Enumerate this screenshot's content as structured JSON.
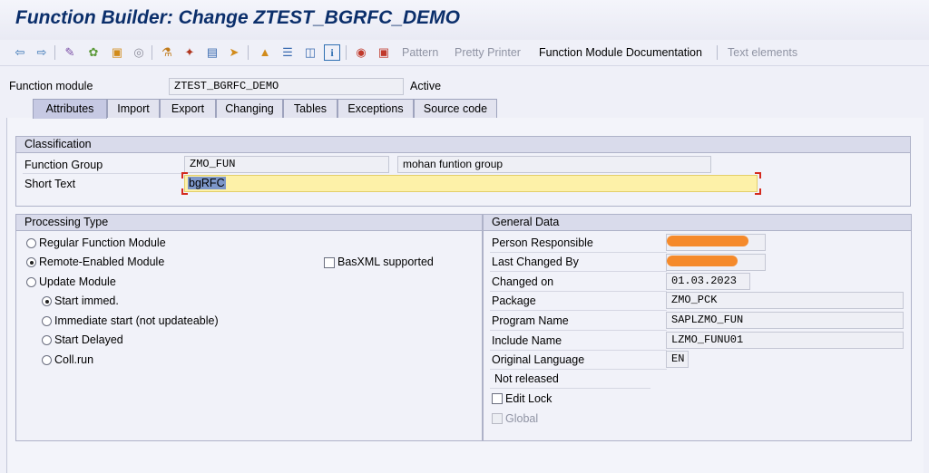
{
  "window": {
    "title": "Function Builder: Change ZTEST_BGRFC_DEMO"
  },
  "toolbar": {
    "icons": [
      "back-icon",
      "forward-icon",
      "display-change-icon",
      "object-list-icon",
      "other-object-icon",
      "where-used-icon",
      "check-icon",
      "activate-icon",
      "test-icon",
      "navigation-window-icon",
      "hierarchy-icon",
      "stack-icon",
      "layout-icon",
      "info-icon",
      "breakpoint-icon",
      "session-breakpoint-icon"
    ],
    "pattern": "Pattern",
    "pretty_printer": "Pretty Printer",
    "fm_documentation": "Function Module Documentation",
    "text_elements": "Text elements"
  },
  "header": {
    "function_module_label": "Function module",
    "function_module_value": "ZTEST_BGRFC_DEMO",
    "status": "Active"
  },
  "tabs": [
    "Attributes",
    "Import",
    "Export",
    "Changing",
    "Tables",
    "Exceptions",
    "Source code"
  ],
  "active_tab": "Attributes",
  "classification": {
    "title": "Classification",
    "function_group_label": "Function Group",
    "function_group_value": "ZMO_FUN",
    "function_group_desc": "mohan funtion group",
    "short_text_label": "Short Text",
    "short_text_value": "bgRFC"
  },
  "processing": {
    "title": "Processing Type",
    "regular": "Regular Function Module",
    "remote": "Remote-Enabled Module",
    "basxml": "BasXML supported",
    "update": "Update Module",
    "start_immed": "Start immed.",
    "immediate_start": "Immediate start (not updateable)",
    "start_delayed": "Start Delayed",
    "coll_run": "Coll.run",
    "selected_main": "remote",
    "selected_update": "start_immed"
  },
  "general": {
    "title": "General Data",
    "person_label": "Person Responsible",
    "last_changed_label": "Last Changed By",
    "changed_on_label": "Changed on",
    "changed_on_value": "01.03.2023",
    "package_label": "Package",
    "package_value": "ZMO_PCK",
    "program_label": "Program Name",
    "program_value": "SAPLZMO_FUN",
    "include_label": "Include Name",
    "include_value": "LZMO_FUNU01",
    "language_label": "Original Language",
    "language_value": "EN",
    "release_status": "Not released",
    "edit_lock": "Edit Lock",
    "global": "Global"
  },
  "colors": {
    "title": "#0b2f6b",
    "highlight": "#fdf1a8",
    "redaction": "#f58a2b"
  }
}
